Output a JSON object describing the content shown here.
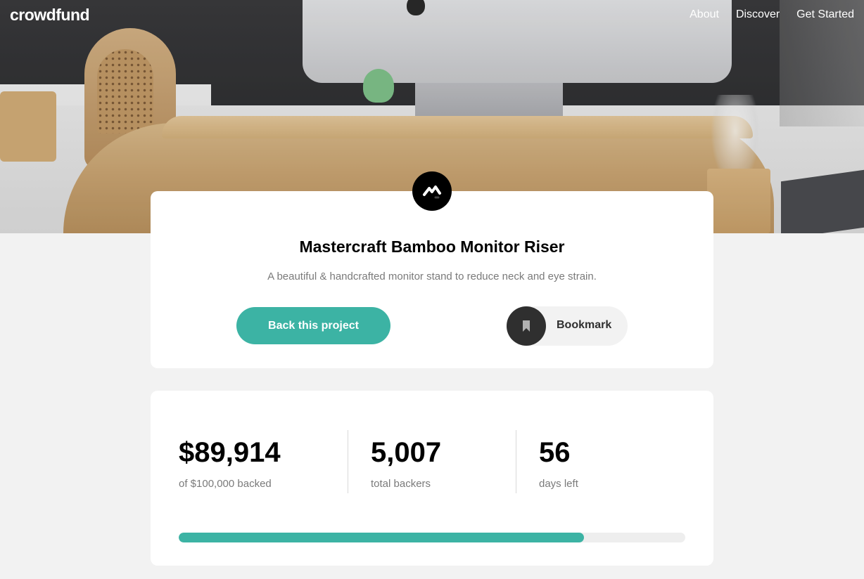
{
  "brand": {
    "logo": "crowdfund"
  },
  "nav": {
    "items": [
      "About",
      "Discover",
      "Get Started"
    ]
  },
  "project": {
    "title": "Mastercraft Bamboo Monitor Riser",
    "description": "A beautiful & handcrafted monitor stand to reduce neck and eye strain.",
    "logo_icon": "mastercraft-logo-icon",
    "back_label": "Back this project",
    "bookmark_label": "Bookmark",
    "bookmark_icon": "bookmark-icon"
  },
  "stats": {
    "backed_amount": "$89,914",
    "backed_label": "of $100,000 backed",
    "total_backers": "5,007",
    "backers_label": "total backers",
    "days_left": "56",
    "days_label": "days left",
    "progress_fraction": 0.8
  },
  "colors": {
    "accent": "#3cb3a4",
    "dark": "#2f2f2f",
    "background": "#f2f2f2",
    "muted_text": "#7a7a7a"
  }
}
